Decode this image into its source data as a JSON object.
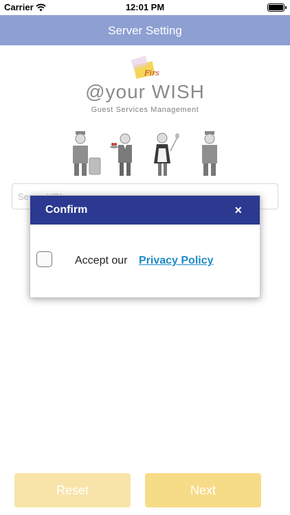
{
  "status_bar": {
    "carrier": "Carrier",
    "time": "12:01 PM"
  },
  "nav": {
    "title": "Server Setting"
  },
  "brand": {
    "logo_word": "First",
    "title": "@your WISH",
    "subtitle": "Guest Services Management"
  },
  "form": {
    "server_url_placeholder": "Server URL"
  },
  "dialog": {
    "title": "Confirm",
    "close": "×",
    "accept_text": "Accept our",
    "privacy_link": "Privacy Policy"
  },
  "buttons": {
    "reset": "Reset",
    "next": "Next"
  },
  "colors": {
    "nav": "#8e9fd2",
    "dialog_header": "#2b3990",
    "link": "#1f8ac6",
    "button": "#f7dc88"
  }
}
